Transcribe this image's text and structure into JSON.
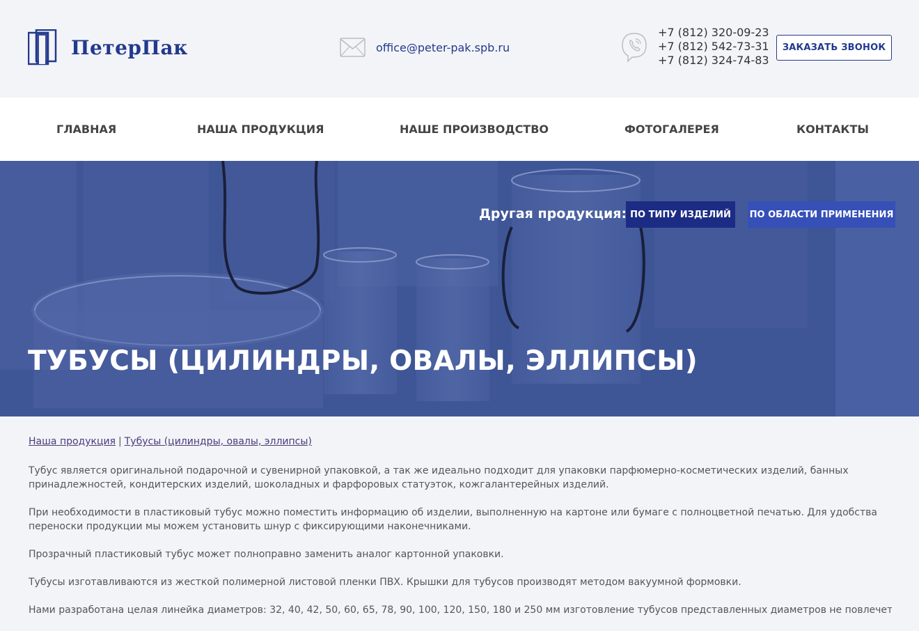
{
  "header": {
    "logo_text": "ПетерПак",
    "email": "office@peter-pak.spb.ru",
    "phones": [
      "+7 (812) 320-09-23",
      "+7 (812) 542-73-31",
      "+7 (812) 324-74-83"
    ],
    "callback_label": "ЗАКАЗАТЬ ЗВОНОК"
  },
  "nav": {
    "items": [
      "ГЛАВНАЯ",
      "НАША ПРОДУКЦИЯ",
      "НАШЕ ПРОИЗВОДСТВО",
      "ФОТОГАЛЕРЕЯ",
      "КОНТАКТЫ"
    ]
  },
  "hero": {
    "other_label": "Другая продукция:",
    "by_type": "ПО ТИПУ ИЗДЕЛИЙ",
    "by_area": "ПО ОБЛАСТИ ПРИМЕНЕНИЯ",
    "title": "ТУБУСЫ (ЦИЛИНДРЫ, ОВАЛЫ, ЭЛЛИПСЫ)"
  },
  "breadcrumbs": {
    "items": [
      "Наша продукция",
      "Тубусы (цилиндры, овалы, эллипсы)"
    ],
    "separator": "|"
  },
  "paragraphs": [
    "Тубус является оригинальной подарочной и сувенирной упаковкой, а так же идеально подходит для упаковки парфюмерно-косметических изделий, банных принадлежностей, кондитерских изделий, шоколадных и фарфоровых статуэток, кожгалантерейных изделий.",
    "При необходимости в пластиковый тубус можно поместить информацию об изделии, выполненную на картоне или бумаге с полноцветной печатью. Для удобства переноски продукции мы можем установить шнур с фиксирующими наконечниками.",
    "Прозрачный пластиковый тубус может полноправно заменить аналог картонной упаковки.",
    "Тубусы изготавливаются из жесткой полимерной листовой пленки ПВХ. Крышки для тубусов производят методом вакуумной формовки.",
    "Нами разработана целая линейка диаметров: 32, 40, 42, 50, 60, 65, 78, 90, 100, 120, 150, 180 и 250 мм изготовление тубусов представленных диаметров не повлечет за собой затрат"
  ],
  "colors": {
    "brand": "#223a8c",
    "hero_overlay": "#3d5495",
    "btn_type": "#1c2c84",
    "btn_area": "#3650b8"
  }
}
